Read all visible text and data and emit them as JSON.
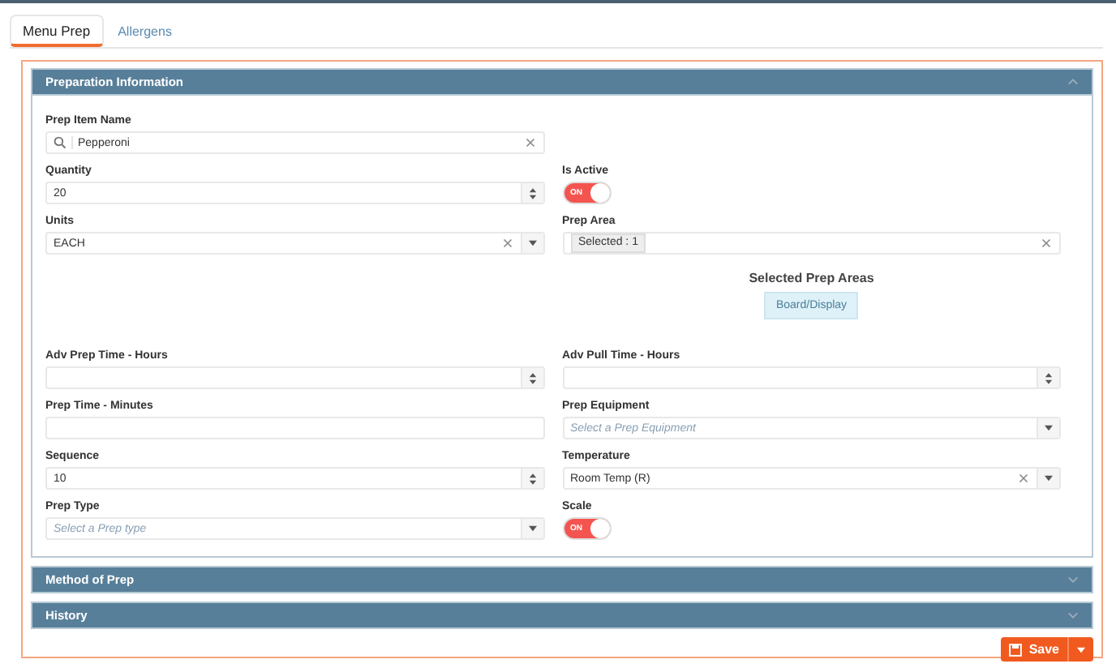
{
  "tabs": [
    {
      "label": "Menu Prep",
      "selected": true
    },
    {
      "label": "Allergens",
      "selected": false
    }
  ],
  "panels": [
    {
      "title": "Preparation Information",
      "expanded": true
    },
    {
      "title": "Method of Prep",
      "expanded": false
    },
    {
      "title": "History",
      "expanded": false
    }
  ],
  "form_rows": [
    {
      "left": {
        "kind": "search",
        "label": "Prep Item Name",
        "value": "Pepperoni",
        "clearable": true
      }
    },
    {
      "left": {
        "kind": "number",
        "label": "Quantity",
        "value": "20"
      },
      "right": {
        "kind": "toggle",
        "label": "Is Active",
        "on": true,
        "text": "ON"
      }
    },
    {
      "left": {
        "kind": "select",
        "label": "Units",
        "value": "EACH",
        "clearable": true
      },
      "right": {
        "kind": "multiselect",
        "label": "Prep Area",
        "tag": "Selected : 1",
        "clearable": true
      }
    },
    {
      "right": {
        "kind": "areas",
        "label": "Selected Prep Areas",
        "chips": [
          "Board/Display"
        ]
      }
    },
    {
      "left": {
        "kind": "number",
        "label": "Adv Prep Time - Hours"
      },
      "right": {
        "kind": "number",
        "label": "Adv Pull Time - Hours"
      }
    },
    {
      "left": {
        "kind": "text",
        "label": "Prep Time - Minutes"
      },
      "right": {
        "kind": "select",
        "label": "Prep Equipment",
        "placeholder": "Select a Prep Equipment",
        "clearable": false
      }
    },
    {
      "left": {
        "kind": "number",
        "label": "Sequence",
        "value": "10"
      },
      "right": {
        "kind": "select",
        "label": "Temperature",
        "value": "Room Temp (R)",
        "clearable": true
      }
    },
    {
      "left": {
        "kind": "select",
        "label": "Prep Type",
        "placeholder": "Select a Prep type",
        "clearable": false
      },
      "right": {
        "kind": "toggle",
        "label": "Scale",
        "on": true,
        "text": "ON"
      }
    }
  ],
  "save_button": {
    "label": "Save"
  }
}
